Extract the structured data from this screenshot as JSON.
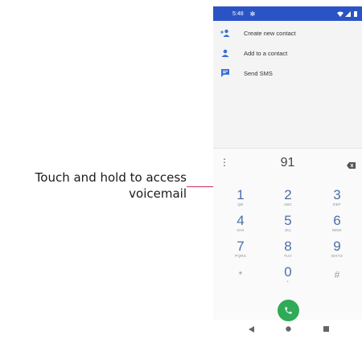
{
  "callout": {
    "line1": "Touch and hold to access",
    "line2": "voicemail"
  },
  "statusbar": {
    "time": "5:48",
    "icons": [
      "gear-icon",
      "wifi-icon",
      "signal-icon",
      "battery-icon"
    ]
  },
  "actions": [
    {
      "label": "Create new contact",
      "icon": "add-person-icon"
    },
    {
      "label": "Add to a contact",
      "icon": "person-icon"
    },
    {
      "label": "Send SMS",
      "icon": "message-icon"
    }
  ],
  "dialer": {
    "typed_number": "91",
    "keys": [
      {
        "digit": "1",
        "letters": "QD"
      },
      {
        "digit": "2",
        "letters": "ABC"
      },
      {
        "digit": "3",
        "letters": "DEF"
      },
      {
        "digit": "4",
        "letters": "GHI"
      },
      {
        "digit": "5",
        "letters": "JKL"
      },
      {
        "digit": "6",
        "letters": "MNO"
      },
      {
        "digit": "7",
        "letters": "PQRS"
      },
      {
        "digit": "8",
        "letters": "TUV"
      },
      {
        "digit": "9",
        "letters": "WXYZ"
      },
      {
        "digit": "*",
        "letters": ""
      },
      {
        "digit": "0",
        "letters": "+"
      },
      {
        "digit": "#",
        "letters": ""
      }
    ]
  },
  "colors": {
    "statusbar": "#2a54c6",
    "accent": "#4a6ea9",
    "call": "#2faa57",
    "callout_line": "#cc2a6b"
  }
}
